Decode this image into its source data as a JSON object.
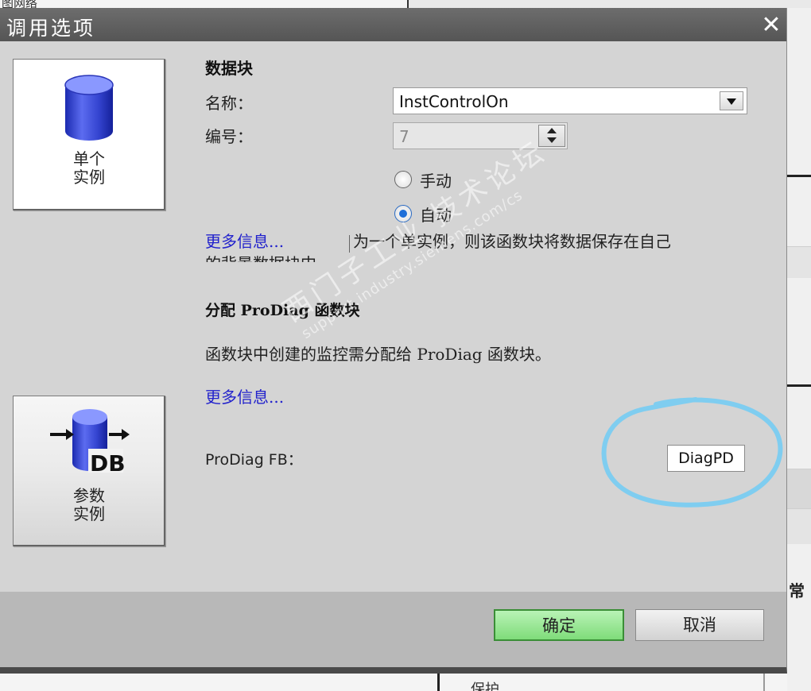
{
  "background": {
    "top_left_text": "图网络",
    "right_side_char": "常",
    "bottom_text": "保护"
  },
  "dialog": {
    "title": "调用选项",
    "close_icon": "close-icon",
    "instance_types": [
      {
        "label_line1": "单个",
        "label_line2": "实例",
        "icon": "database-cylinder-icon",
        "selected": true
      },
      {
        "label_line1": "参数",
        "label_line2": "实例",
        "icon": "db-parameter-icon",
        "icon_text": "DB",
        "selected": false
      }
    ],
    "data_block": {
      "heading": "数据块",
      "name_label": "名称：",
      "name_value": "InstControlOn",
      "number_label": "编号：",
      "number_value": "7",
      "radio_manual": "手动",
      "radio_auto": "自动",
      "selected_mode": "自动",
      "more_info_link": "更多信息...",
      "description_line1": "为一个单实例，则该函数块将数据保存在自己",
      "description_line2": "的背景数据块中"
    },
    "prodiag": {
      "heading": "分配 ProDiag 函数块",
      "description": "函数块中创建的监控需分配给 ProDiag 函数块。",
      "more_info_link": "更多信息...",
      "fb_label": "ProDiag FB：",
      "fb_value": "DiagPD"
    },
    "watermark": {
      "line1": "西门子工业 技术论坛",
      "line2": "support.industry.siemens.com/cs"
    },
    "footer": {
      "ok_label": "确定",
      "cancel_label": "取消"
    },
    "colors": {
      "ok_button": "#8fe28a",
      "link": "#2222cc",
      "annotation_circle": "#7fcdf0",
      "radio_selected": "#1f6fd8"
    }
  }
}
